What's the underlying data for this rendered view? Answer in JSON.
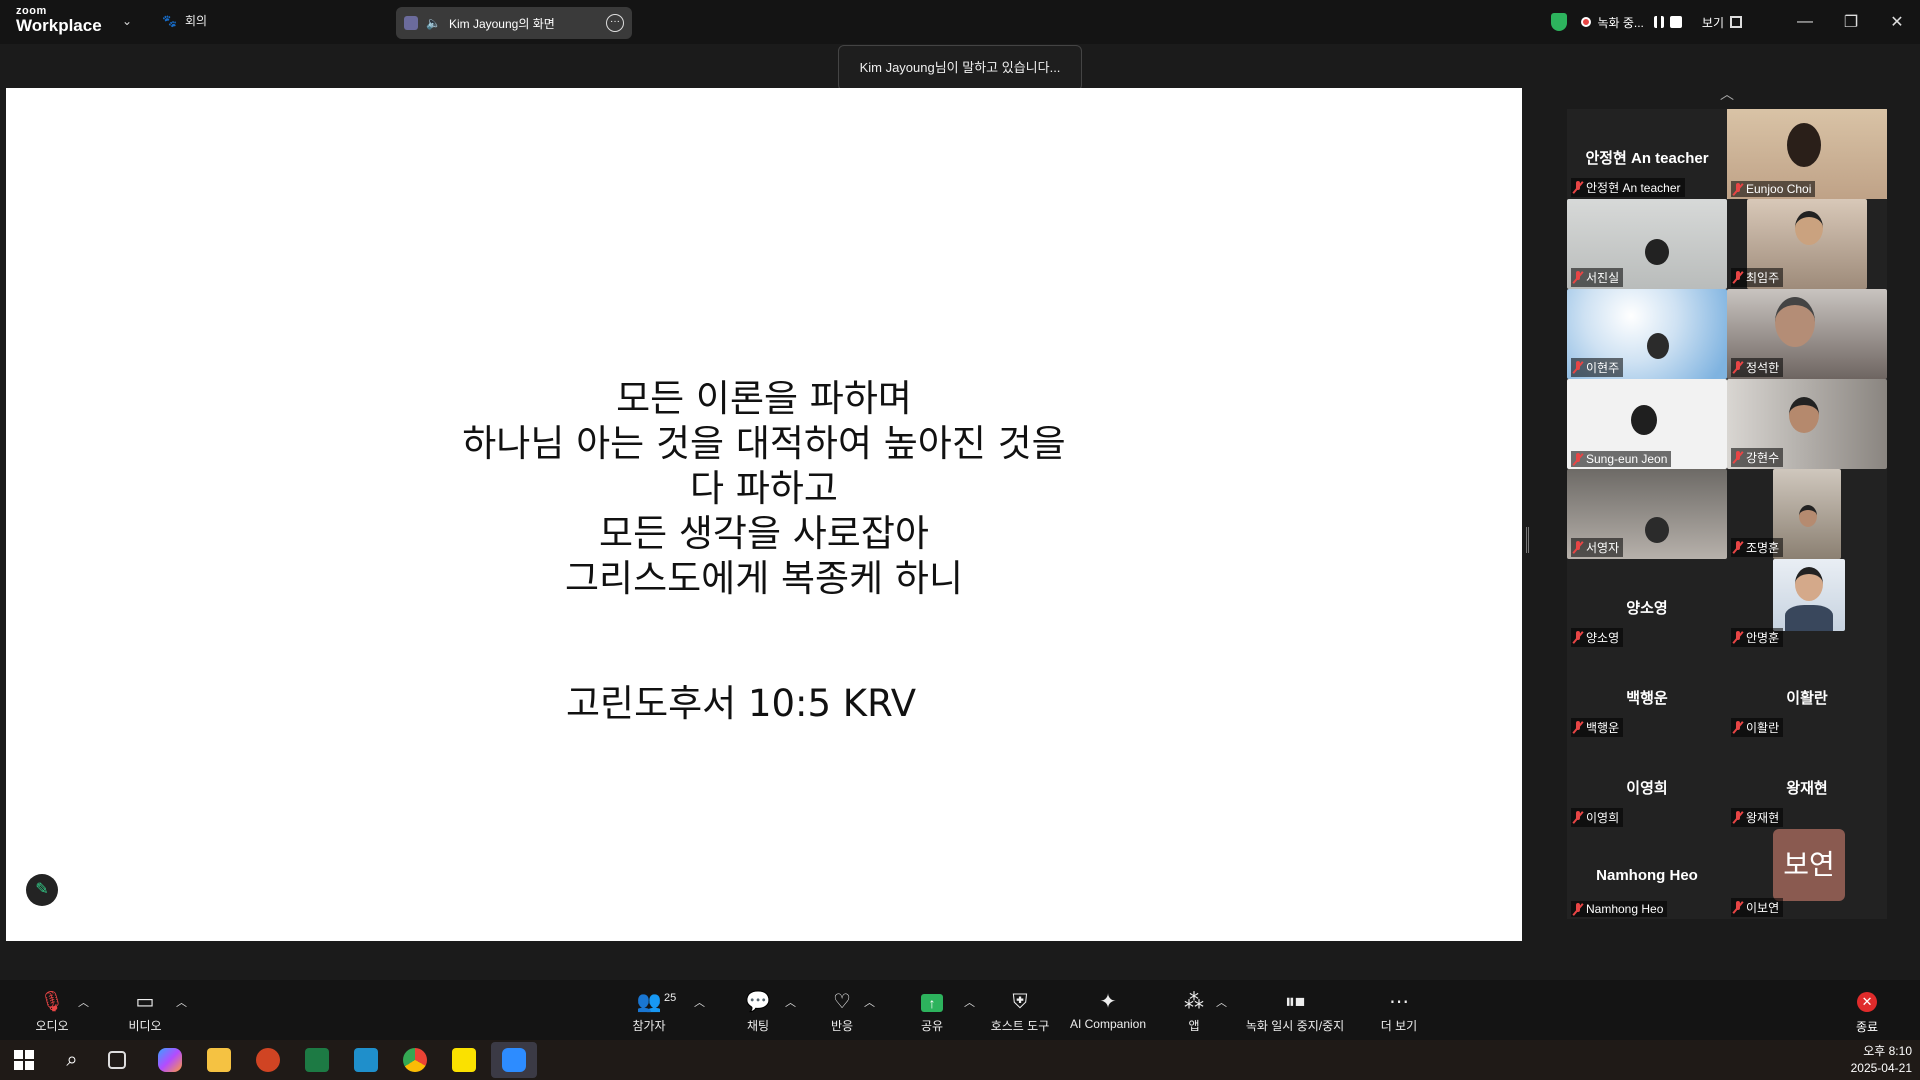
{
  "app": {
    "brand_small": "zoom",
    "brand_large": "Workplace",
    "meeting_label": "회의"
  },
  "share_indicator": {
    "label": "Kim Jayoung의 화면"
  },
  "top_right": {
    "recording_label": "녹화 중...",
    "view_label": "보기"
  },
  "toast": {
    "text": "Kim Jayoung님이 말하고 있습니다..."
  },
  "slide": {
    "lines": [
      "모든 이론을 파하며",
      "하나님 아는 것을 대적하여 높아진 것을",
      "다 파하고",
      "모든 생각을 사로잡아",
      "그리스도에게 복종케 하니"
    ],
    "reference": "고린도후서 10:5 KRV"
  },
  "participants": [
    {
      "name": "안정현 An teacher",
      "display": "안정현 An teacher",
      "video": false
    },
    {
      "name": "Eunjoo Choi",
      "video": true
    },
    {
      "name": "서진실",
      "video": true
    },
    {
      "name": "최임주",
      "video": true
    },
    {
      "name": "이현주",
      "video": true
    },
    {
      "name": "정석한",
      "video": true
    },
    {
      "name": "Sung-eun Jeon",
      "video": true
    },
    {
      "name": "강현수",
      "video": true
    },
    {
      "name": "서영자",
      "video": true
    },
    {
      "name": "조명훈",
      "video": true
    },
    {
      "name": "양소영",
      "display": "양소영",
      "video": false
    },
    {
      "name": "안명훈",
      "video": true
    },
    {
      "name": "백행운",
      "display": "백행운",
      "video": false
    },
    {
      "name": "이활란",
      "display": "이활란",
      "video": false
    },
    {
      "name": "이영희",
      "display": "이영희",
      "video": false
    },
    {
      "name": "왕재현",
      "display": "왕재현",
      "video": false
    },
    {
      "name": "Namhong Heo",
      "display": "Namhong Heo",
      "video": false
    },
    {
      "name": "이보연",
      "avatar_text": "보연",
      "video": false
    }
  ],
  "toolbar": {
    "audio": "오디오",
    "video": "비디오",
    "participants": "참가자",
    "participant_count": "25",
    "chat": "채팅",
    "reactions": "반응",
    "share": "공유",
    "host_tools": "호스트 도구",
    "ai_companion": "AI Companion",
    "apps": "앱",
    "recording": "녹화 일시 중지/중지",
    "more": "더 보기",
    "end": "종료"
  },
  "taskbar": {
    "time": "오후 8:10",
    "date": "2025-04-21"
  },
  "colors": {
    "accent_green": "#2db35d",
    "mute_red": "#e84545",
    "end_red": "#e02b2b"
  }
}
